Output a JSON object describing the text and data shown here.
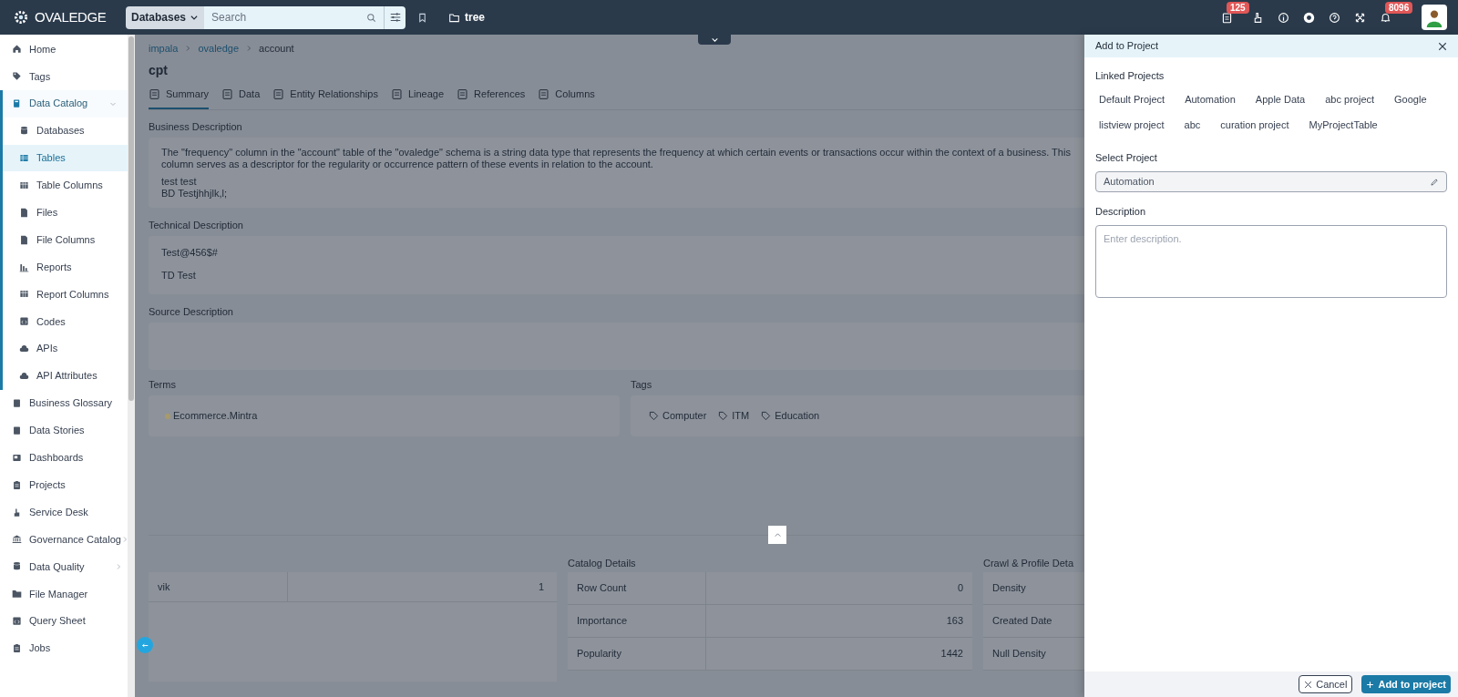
{
  "header": {
    "logo": "OVALEDGE",
    "search": {
      "scope": "Databases",
      "placeholder": "Search"
    },
    "folder": "tree",
    "badges": [
      {
        "kind": "clipboard",
        "count": "125"
      },
      {
        "kind": "hand"
      },
      {
        "kind": "info"
      },
      {
        "kind": "chrome"
      },
      {
        "kind": "help"
      },
      {
        "kind": "expand"
      },
      {
        "kind": "bell",
        "count": "8096"
      }
    ]
  },
  "sidebar": {
    "items": [
      {
        "label": "Home",
        "selected": false
      },
      {
        "label": "Tags",
        "selected": false
      },
      {
        "label": "Data Catalog",
        "selected": false,
        "expanded": true,
        "children": [
          {
            "label": "Databases",
            "selected": false
          },
          {
            "label": "Tables",
            "selected": true
          },
          {
            "label": "Table Columns",
            "selected": false
          },
          {
            "label": "Files",
            "selected": false
          },
          {
            "label": "File Columns",
            "selected": false
          },
          {
            "label": "Reports",
            "selected": false
          },
          {
            "label": "Report Columns",
            "selected": false
          },
          {
            "label": "Codes",
            "selected": false
          },
          {
            "label": "APIs",
            "selected": false
          },
          {
            "label": "API Attributes",
            "selected": false
          }
        ]
      },
      {
        "label": "Business Glossary",
        "selected": false
      },
      {
        "label": "Data Stories",
        "selected": false
      },
      {
        "label": "Dashboards",
        "selected": false
      },
      {
        "label": "Projects",
        "selected": false
      },
      {
        "label": "Service Desk",
        "selected": false
      },
      {
        "label": "Governance Catalog",
        "selected": false,
        "expanded": false
      },
      {
        "label": "Data Quality",
        "selected": false,
        "expanded": false
      },
      {
        "label": "File Manager",
        "selected": false
      },
      {
        "label": "Query Sheet",
        "selected": false
      },
      {
        "label": "Jobs",
        "selected": false
      }
    ]
  },
  "breadcrumb": [
    "impala",
    "ovaledge",
    "account"
  ],
  "title": "cpt",
  "tabs": [
    {
      "label": "Summary",
      "selected": true
    },
    {
      "label": "Data",
      "selected": false
    },
    {
      "label": "Entity Relationships",
      "selected": false
    },
    {
      "label": "Lineage",
      "selected": false
    },
    {
      "label": "References",
      "selected": false
    },
    {
      "label": "Columns",
      "selected": false
    }
  ],
  "business_description": {
    "label": "Business Description",
    "lines": [
      "The \"frequency\" column in the \"account\" table of the \"ovaledge\" schema is a string data type that represents the frequency at which certain events or transactions occur within the context of a business. This column serves as a descriptor for the regularity or occurrence pattern of these events in relation to the account.",
      "test test",
      "BD Testjhhjlk,l;"
    ]
  },
  "technical_description": {
    "label": "Technical Description",
    "lines": [
      "Test@456$#",
      "TD Test"
    ]
  },
  "source_description": {
    "label": "Source Description"
  },
  "terms": {
    "label": "Terms",
    "items": [
      {
        "label": "Ecommerce.Mintra",
        "color": "#a89a6a"
      }
    ]
  },
  "tags": {
    "label": "Tags",
    "items": [
      "Computer",
      "ITM",
      "Education"
    ]
  },
  "left_table": {
    "rows": [
      [
        "vik",
        "1"
      ]
    ]
  },
  "catalog_details": {
    "label": "Catalog Details",
    "rows": [
      [
        "Row Count",
        "0"
      ],
      [
        "Importance",
        "163"
      ],
      [
        "Popularity",
        "1442"
      ]
    ]
  },
  "crawl_details": {
    "label": "Crawl & Profile Deta",
    "rows": [
      "Density",
      "Created Date",
      "Null Density"
    ]
  },
  "panel": {
    "title": "Add to Project",
    "linked_label": "Linked Projects",
    "linked": [
      [
        "Default Project",
        "Automation",
        "Apple Data",
        "abc project",
        "Google"
      ],
      [
        "listview project",
        "abc",
        "curation project",
        "MyProjectTable"
      ]
    ],
    "select_label": "Select Project",
    "select_value": "Automation",
    "description_label": "Description",
    "description_placeholder": "Enter description.",
    "buttons": [
      {
        "kind": "cancel",
        "label": "Cancel"
      },
      {
        "kind": "primary",
        "label": "Add to project"
      }
    ]
  }
}
